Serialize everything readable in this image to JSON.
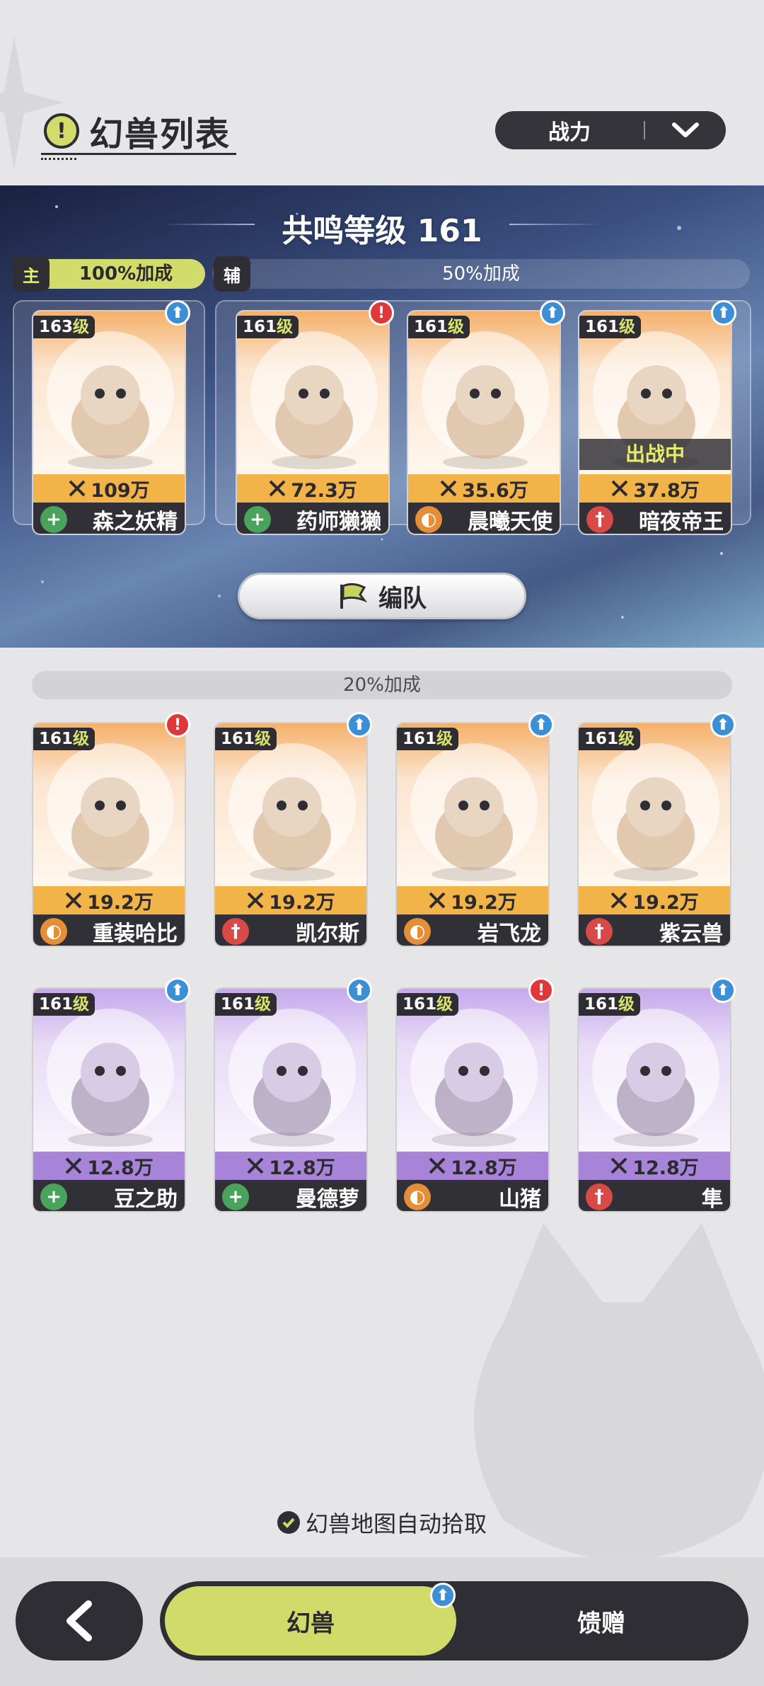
{
  "header": {
    "title": "幻兽列表",
    "title_icon": "!",
    "sort_label": "战力"
  },
  "resonance": {
    "title": "共鸣等级 161",
    "main_tag": "主",
    "main_bonus": "100%加成",
    "sub_tag": "辅",
    "sub_bonus": "50%加成",
    "team_button": "编队"
  },
  "team_cards": [
    {
      "level": "163",
      "level_suffix": "级",
      "power": "109万",
      "name": "森之妖精",
      "role": "plus",
      "badge": "up",
      "rarity": "gold"
    },
    {
      "level": "161",
      "level_suffix": "级",
      "power": "72.3万",
      "name": "药师獭獭",
      "role": "plus",
      "badge": "alert",
      "rarity": "gold"
    },
    {
      "level": "161",
      "level_suffix": "级",
      "power": "35.6万",
      "name": "晨曦天使",
      "role": "shield",
      "badge": "up",
      "rarity": "gold"
    },
    {
      "level": "161",
      "level_suffix": "级",
      "power": "37.8万",
      "name": "暗夜帝王",
      "role": "sword",
      "badge": "up",
      "rarity": "gold",
      "status": "出战中"
    }
  ],
  "section2": {
    "bonus": "20%加成"
  },
  "beast_cards": [
    {
      "level": "161",
      "level_suffix": "级",
      "power": "19.2万",
      "name": "重装哈比",
      "role": "shield",
      "badge": "alert",
      "rarity": "gold"
    },
    {
      "level": "161",
      "level_suffix": "级",
      "power": "19.2万",
      "name": "凯尔斯",
      "role": "sword",
      "badge": "up",
      "rarity": "gold"
    },
    {
      "level": "161",
      "level_suffix": "级",
      "power": "19.2万",
      "name": "岩飞龙",
      "role": "shield",
      "badge": "up",
      "rarity": "gold"
    },
    {
      "level": "161",
      "level_suffix": "级",
      "power": "19.2万",
      "name": "紫云兽",
      "role": "sword",
      "badge": "up",
      "rarity": "gold"
    },
    {
      "level": "161",
      "level_suffix": "级",
      "power": "12.8万",
      "name": "豆之助",
      "role": "plus",
      "badge": "up",
      "rarity": "purple"
    },
    {
      "level": "161",
      "level_suffix": "级",
      "power": "12.8万",
      "name": "曼德萝",
      "role": "plus",
      "badge": "up",
      "rarity": "purple"
    },
    {
      "level": "161",
      "level_suffix": "级",
      "power": "12.8万",
      "name": "山猪",
      "role": "shield",
      "badge": "alert",
      "rarity": "purple"
    },
    {
      "level": "161",
      "level_suffix": "级",
      "power": "12.8万",
      "name": "隼",
      "role": "sword",
      "badge": "up",
      "rarity": "purple"
    }
  ],
  "footer": {
    "auto_pickup": "幻兽地图自动拾取",
    "tab_beast": "幻兽",
    "tab_gift": "馈赠",
    "tab_beast_badge": "up"
  },
  "colors": {
    "accent": "#d1db6a",
    "dark": "#2e2e34",
    "gold": "#f2b349",
    "purple": "#a884d8",
    "up_badge": "#3b8fd6",
    "alert_badge": "#e0383a"
  }
}
